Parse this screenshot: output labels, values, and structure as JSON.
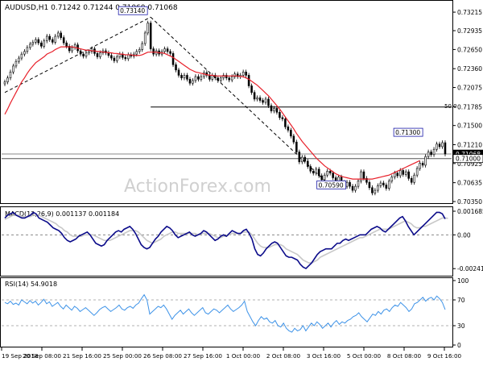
{
  "header": {
    "symbol_line": "AUDUSD,H1  0.71242 0.71244 0.71060 0.71068"
  },
  "watermark": "ActionForex.com",
  "colors": {
    "candle": "#000000",
    "ema": "#e8202a",
    "trendline": "#000000",
    "level_line": "#000000",
    "macd_line": "#0b0b8a",
    "signal_line": "#c8c8c8",
    "rsi_line": "#3e93e8",
    "label_border": "#1a1aa8",
    "grid_text": "#000000"
  },
  "chart_data": [
    {
      "name": "price",
      "type": "line",
      "title": "AUDUSD,H1",
      "ohlc_last": {
        "open": 0.71242,
        "high": 0.71244,
        "low": 0.7106,
        "close": 0.71068
      },
      "ylim": [
        0.7035,
        0.7335
      ],
      "yticks": [
        0.7035,
        0.70635,
        0.70925,
        0.7121,
        0.715,
        0.71785,
        0.72075,
        0.7236,
        0.7265,
        0.72935,
        0.73215
      ],
      "ytick_labels": [
        "0.70350",
        "0.70635",
        "0.70925",
        "0.71210",
        "0.71500",
        "0.71785",
        "0.72075",
        "0.72360",
        "0.72650",
        "0.72935",
        "0.73215"
      ],
      "xlim": [
        0,
        158
      ],
      "xticks": [
        0,
        20,
        40,
        60,
        80,
        100,
        120,
        140,
        160,
        180,
        200
      ],
      "xtick_labels": [
        "19 Sep 2018",
        "20 Sep 08:00",
        "21 Sep 16:00",
        "25 Sep 00:00",
        "26 Sep 08:00",
        "27 Sep 16:00",
        "1 Oct 00:00",
        "2 Oct 08:00",
        "3 Oct 16:00",
        "5 Oct 00:00",
        "8 Oct 08:00",
        "9 Oct 16:00"
      ],
      "close_series": [
        0.7216,
        0.7222,
        0.7231,
        0.724,
        0.7247,
        0.7252,
        0.7258,
        0.7262,
        0.7268,
        0.7273,
        0.7276,
        0.728,
        0.7275,
        0.727,
        0.7278,
        0.7285,
        0.728,
        0.7276,
        0.7285,
        0.729,
        0.7283,
        0.7275,
        0.727,
        0.7263,
        0.7268,
        0.7272,
        0.7263,
        0.7258,
        0.7255,
        0.726,
        0.7262,
        0.7266,
        0.7259,
        0.7254,
        0.726,
        0.7263,
        0.726,
        0.7256,
        0.7252,
        0.7248,
        0.7254,
        0.7258,
        0.7253,
        0.7251,
        0.7257,
        0.7255,
        0.7258,
        0.7262,
        0.7265,
        0.7274,
        0.729,
        0.7305,
        0.7266,
        0.7258,
        0.7263,
        0.7258,
        0.7262,
        0.7266,
        0.7262,
        0.7259,
        0.7242,
        0.7234,
        0.7226,
        0.7222,
        0.7226,
        0.722,
        0.7214,
        0.7218,
        0.7224,
        0.722,
        0.7224,
        0.723,
        0.7226,
        0.722,
        0.7226,
        0.7222,
        0.7218,
        0.7222,
        0.7226,
        0.7222,
        0.7219,
        0.7224,
        0.7228,
        0.7224,
        0.7226,
        0.7231,
        0.7226,
        0.721,
        0.72,
        0.719,
        0.7192,
        0.7188,
        0.7185,
        0.719,
        0.718,
        0.7172,
        0.7176,
        0.717,
        0.7162,
        0.716,
        0.7148,
        0.7143,
        0.7134,
        0.7125,
        0.711,
        0.7095,
        0.7102,
        0.7096,
        0.7088,
        0.7081,
        0.7078,
        0.7084,
        0.7074,
        0.7068,
        0.7075,
        0.7081,
        0.7078,
        0.7071,
        0.7065,
        0.7072,
        0.7064,
        0.7058,
        0.7064,
        0.7058,
        0.7052,
        0.7058,
        0.7066,
        0.708,
        0.707,
        0.7064,
        0.7056,
        0.7048,
        0.7052,
        0.7059,
        0.7063,
        0.706,
        0.7055,
        0.7066,
        0.7072,
        0.7078,
        0.7074,
        0.7082,
        0.7076,
        0.708,
        0.707,
        0.7064,
        0.7075,
        0.7085,
        0.7093,
        0.709,
        0.7103,
        0.711,
        0.7106,
        0.7114,
        0.7122,
        0.7118,
        0.7124,
        0.7107
      ],
      "ema_series": [
        0.7167,
        0.7175,
        0.7184,
        0.7192,
        0.72,
        0.7208,
        0.7216,
        0.7222,
        0.7229,
        0.7235,
        0.724,
        0.7245,
        0.7248,
        0.7251,
        0.7254,
        0.7258,
        0.726,
        0.7262,
        0.7265,
        0.7267,
        0.7269,
        0.7269,
        0.7269,
        0.7269,
        0.7269,
        0.7268,
        0.7267,
        0.7266,
        0.7265,
        0.7264,
        0.7264,
        0.7263,
        0.7263,
        0.7262,
        0.7262,
        0.7261,
        0.7261,
        0.726,
        0.726,
        0.7259,
        0.7259,
        0.7258,
        0.7258,
        0.7257,
        0.7257,
        0.7257,
        0.7256,
        0.7256,
        0.7256,
        0.7257,
        0.7259,
        0.7261,
        0.7261,
        0.7261,
        0.7261,
        0.726,
        0.726,
        0.7259,
        0.7257,
        0.7255,
        0.7253,
        0.725,
        0.7247,
        0.7244,
        0.7241,
        0.7238,
        0.7235,
        0.7233,
        0.7231,
        0.723,
        0.7229,
        0.7228,
        0.7227,
        0.7226,
        0.7226,
        0.7225,
        0.7225,
        0.7225,
        0.7225,
        0.7225,
        0.7225,
        0.7225,
        0.7225,
        0.7225,
        0.7224,
        0.7224,
        0.7222,
        0.722,
        0.7217,
        0.7214,
        0.7211,
        0.7207,
        0.7203,
        0.7199,
        0.7195,
        0.719,
        0.7185,
        0.718,
        0.7175,
        0.7169,
        0.7163,
        0.7157,
        0.7151,
        0.7145,
        0.7138,
        0.7132,
        0.7126,
        0.7121,
        0.7116,
        0.7111,
        0.7106,
        0.7101,
        0.7097,
        0.7093,
        0.7089,
        0.7086,
        0.7083,
        0.708,
        0.7077,
        0.7075,
        0.7073,
        0.7072,
        0.7071,
        0.707,
        0.7069,
        0.7069,
        0.7069,
        0.7069,
        0.7069,
        0.7069,
        0.7069,
        0.7069,
        0.707,
        0.7071,
        0.7072,
        0.7073,
        0.7074,
        0.7075,
        0.7077,
        0.7079,
        0.7081,
        0.7083,
        0.7085,
        0.7087,
        0.7089,
        0.7091,
        0.7093,
        0.7095,
        0.7097
      ],
      "trendlines": [
        {
          "from": [
            0,
            0.72
          ],
          "to": [
            52,
            0.7314
          ]
        },
        {
          "from": [
            52,
            0.7314
          ],
          "to": [
            117,
            0.7055
          ]
        }
      ],
      "level_line": {
        "value": 0.7178,
        "from_x": 52,
        "label": "50.0"
      },
      "level_line_2": {
        "value": 0.71
      },
      "level_line_3": {
        "value": 0.7107
      },
      "annotations": [
        {
          "label": "0.73140",
          "x": 52,
          "y": 0.7314
        },
        {
          "label": "0.71300",
          "x": 149,
          "y": 0.713
        },
        {
          "label": "0.70590",
          "x": 117,
          "y": 0.7059
        }
      ],
      "price_tags": [
        {
          "label": "0.71068",
          "y": 0.71068
        },
        {
          "label": "0.71000",
          "y": 0.71
        }
      ]
    },
    {
      "name": "macd",
      "type": "line",
      "title": "MACD(12,26,9) 0.001137 0.001184",
      "ylim": [
        -0.0028,
        0.0018
      ],
      "ytick_labels": [
        "0.001685",
        "0.00",
        "-0.00241"
      ],
      "yticks": [
        0.001685,
        0.0,
        -0.00241
      ],
      "macd_series": [
        0.0012,
        0.0014,
        0.0015,
        0.0016,
        0.0014,
        0.0013,
        0.0012,
        0.0012,
        0.0013,
        0.0014,
        0.0016,
        0.0015,
        0.0012,
        0.0011,
        0.001,
        0.0009,
        0.0007,
        0.0005,
        0.0004,
        0.0003,
        0.0001,
        -0.0002,
        -0.0004,
        -0.0005,
        -0.0004,
        -0.0003,
        -0.0001,
        0.0,
        0.0001,
        0.0002,
        0.0,
        -0.0003,
        -0.0006,
        -0.0007,
        -0.0008,
        -0.0007,
        -0.0004,
        -0.0002,
        0.0,
        0.0002,
        0.0003,
        0.0002,
        0.0004,
        0.0005,
        0.0006,
        0.0004,
        0.0001,
        -0.0003,
        -0.0007,
        -0.0009,
        -0.001,
        -0.0009,
        -0.0006,
        -0.0003,
        -0.0001,
        0.0002,
        0.0004,
        0.0006,
        0.0005,
        0.0003,
        0.0,
        -0.0002,
        -0.0001,
        0.0,
        0.0001,
        0.0002,
        0.0,
        -0.0001,
        0.0,
        0.0001,
        0.0003,
        0.0002,
        0.0,
        -0.0002,
        -0.0004,
        -0.0003,
        -0.0001,
        0.0,
        -0.0001,
        0.0001,
        0.0003,
        0.0002,
        0.0001,
        0.0001,
        0.0003,
        0.0004,
        0.0001,
        -0.0003,
        -0.001,
        -0.0014,
        -0.0015,
        -0.0013,
        -0.001,
        -0.0008,
        -0.0006,
        -0.0005,
        -0.0006,
        -0.0009,
        -0.0012,
        -0.0015,
        -0.0016,
        -0.0016,
        -0.0017,
        -0.0018,
        -0.0021,
        -0.0023,
        -0.0024,
        -0.0022,
        -0.002,
        -0.0017,
        -0.0014,
        -0.0012,
        -0.0011,
        -0.001,
        -0.001,
        -0.001,
        -0.0008,
        -0.0006,
        -0.0006,
        -0.0004,
        -0.0003,
        -0.0004,
        -0.0003,
        -0.0002,
        -0.0001,
        0.0,
        0.0,
        0.0,
        0.0002,
        0.0004,
        0.0005,
        0.0006,
        0.0005,
        0.0003,
        0.0002,
        0.0004,
        0.0006,
        0.0008,
        0.001,
        0.0012,
        0.0013,
        0.001,
        0.0006,
        0.0003,
        0.0,
        0.0002,
        0.0004,
        0.0006,
        0.0008,
        0.001,
        0.0012,
        0.0014,
        0.0016,
        0.0016,
        0.0015,
        0.00114
      ],
      "signal_series": [
        0.0011,
        0.0012,
        0.0013,
        0.0014,
        0.0014,
        0.0014,
        0.0013,
        0.0013,
        0.0013,
        0.0013,
        0.0014,
        0.0014,
        0.0014,
        0.0013,
        0.0012,
        0.0011,
        0.001,
        0.0009,
        0.0008,
        0.0006,
        0.0005,
        0.0003,
        0.0002,
        0.0,
        -0.0001,
        -0.0001,
        -0.0001,
        -0.0001,
        0.0,
        0.0,
        0.0,
        0.0,
        -0.0001,
        -0.0002,
        -0.0003,
        -0.0004,
        -0.0004,
        -0.0004,
        -0.0003,
        -0.0002,
        -0.0001,
        0.0,
        0.0001,
        0.0002,
        0.0003,
        0.0003,
        0.0003,
        0.0002,
        0.0,
        -0.0002,
        -0.0004,
        -0.0005,
        -0.0006,
        -0.0005,
        -0.0004,
        -0.0003,
        -0.0001,
        0.0,
        0.0001,
        0.0002,
        0.0002,
        0.0001,
        0.0001,
        0.0001,
        0.0001,
        0.0001,
        0.0001,
        0.0001,
        0.0,
        0.0001,
        0.0001,
        0.0001,
        0.0001,
        0.0,
        -0.0001,
        -0.0002,
        -0.0002,
        -0.0001,
        -0.0001,
        0.0,
        0.0001,
        0.0001,
        0.0001,
        0.0001,
        0.0002,
        0.0002,
        0.0002,
        0.0,
        -0.0003,
        -0.0006,
        -0.0008,
        -0.0009,
        -0.0009,
        -0.0009,
        -0.0008,
        -0.0007,
        -0.0007,
        -0.0007,
        -0.0008,
        -0.001,
        -0.0011,
        -0.0012,
        -0.0013,
        -0.0014,
        -0.0016,
        -0.0018,
        -0.0019,
        -0.002,
        -0.002,
        -0.0019,
        -0.0018,
        -0.0016,
        -0.0015,
        -0.0014,
        -0.0013,
        -0.0012,
        -0.0011,
        -0.001,
        -0.0009,
        -0.0008,
        -0.0007,
        -0.0006,
        -0.0005,
        -0.0004,
        -0.0003,
        -0.0002,
        -0.0002,
        -0.0001,
        0.0,
        0.0001,
        0.0002,
        0.0003,
        0.0004,
        0.0004,
        0.0004,
        0.0004,
        0.0005,
        0.0006,
        0.0007,
        0.0008,
        0.0009,
        0.001,
        0.0009,
        0.0008,
        0.0006,
        0.0005,
        0.0005,
        0.0006,
        0.0006,
        0.0007,
        0.0008,
        0.0009,
        0.001,
        0.0011,
        0.0012,
        0.0012,
        0.00118
      ]
    },
    {
      "name": "rsi",
      "type": "line",
      "title": "RSI(14) 54.9018",
      "ylim": [
        0,
        100
      ],
      "yticks": [
        100,
        70,
        30,
        0
      ],
      "ytick_labels": [
        "100",
        "70",
        "30",
        "0"
      ],
      "rsi_series": [
        66,
        64,
        68,
        63,
        65,
        62,
        70,
        67,
        64,
        69,
        65,
        68,
        62,
        66,
        71,
        64,
        67,
        60,
        63,
        66,
        60,
        56,
        62,
        58,
        54,
        60,
        57,
        52,
        55,
        58,
        54,
        50,
        46,
        50,
        55,
        58,
        60,
        56,
        52,
        55,
        58,
        62,
        56,
        54,
        58,
        60,
        57,
        62,
        65,
        72,
        78,
        70,
        48,
        52,
        56,
        60,
        58,
        62,
        56,
        48,
        40,
        46,
        50,
        54,
        48,
        52,
        56,
        50,
        46,
        50,
        54,
        58,
        50,
        48,
        52,
        56,
        54,
        50,
        54,
        58,
        62,
        56,
        52,
        55,
        58,
        62,
        68,
        52,
        44,
        36,
        30,
        38,
        44,
        40,
        42,
        36,
        34,
        38,
        30,
        28,
        34,
        26,
        22,
        20,
        26,
        22,
        24,
        30,
        22,
        28,
        34,
        30,
        36,
        32,
        26,
        30,
        34,
        28,
        34,
        38,
        32,
        36,
        34,
        38,
        40,
        44,
        46,
        50,
        44,
        40,
        36,
        42,
        48,
        46,
        52,
        48,
        54,
        56,
        52,
        58,
        62,
        60,
        66,
        62,
        58,
        52,
        56,
        64,
        66,
        70,
        74,
        68,
        72,
        74,
        70,
        76,
        72,
        66,
        54.9
      ]
    }
  ]
}
